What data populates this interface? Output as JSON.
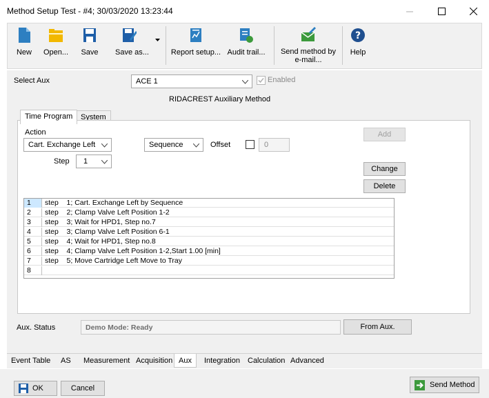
{
  "window": {
    "title": "Method Setup Test - #4;  30/03/2020  13:23:44"
  },
  "toolbar": {
    "new_label": "New",
    "open_label": "Open...",
    "save_label": "Save",
    "saveas_label": "Save as...",
    "report_label": "Report setup...",
    "audit_label": "Audit trail...",
    "sendmail_line1": "Send method by",
    "sendmail_line2": "e-mail...",
    "help_label": "Help"
  },
  "aux": {
    "select_label": "Select Aux",
    "selected": "ACE 1",
    "enabled_label": "Enabled",
    "method_title": "RIDACREST Auxiliary Method"
  },
  "tabs": {
    "time_program": "Time Program",
    "system": "System"
  },
  "program": {
    "action_label": "Action",
    "action_value": "Cart. Exchange Left",
    "sequence_value": "Sequence",
    "offset_label": "Offset",
    "offset_value": "0",
    "step_label": "Step",
    "step_value": "1",
    "add_label": "Add",
    "change_label": "Change",
    "delete_label": "Delete",
    "rows": [
      {
        "num": "1",
        "text": "step    1; Cart. Exchange Left by Sequence"
      },
      {
        "num": "2",
        "text": "step    2; Clamp Valve Left Position 1-2"
      },
      {
        "num": "3",
        "text": "step    3; Wait for HPD1, Step no.7"
      },
      {
        "num": "4",
        "text": "step    3; Clamp Valve Left Position 6-1"
      },
      {
        "num": "5",
        "text": "step    4; Wait for HPD1, Step no.8"
      },
      {
        "num": "6",
        "text": "step    4; Clamp Valve Left Position 1-2,Start 1.00 [min]"
      },
      {
        "num": "7",
        "text": "step    5; Move Cartridge Left Move to Tray"
      },
      {
        "num": "8",
        "text": ""
      }
    ]
  },
  "status": {
    "label": "Aux. Status",
    "value": "Demo Mode: Ready",
    "from_aux_label": "From Aux."
  },
  "bottom_tabs": [
    "Event Table",
    "AS",
    "Measurement",
    "Acquisition",
    "Aux",
    "Integration",
    "Calculation",
    "Advanced"
  ],
  "footer": {
    "ok_label": "OK",
    "cancel_label": "Cancel",
    "send_method_label": "Send Method"
  },
  "colors": {
    "accent": "#2d7fc1",
    "folder": "#f2b800",
    "send_green": "#3c9a3c"
  }
}
